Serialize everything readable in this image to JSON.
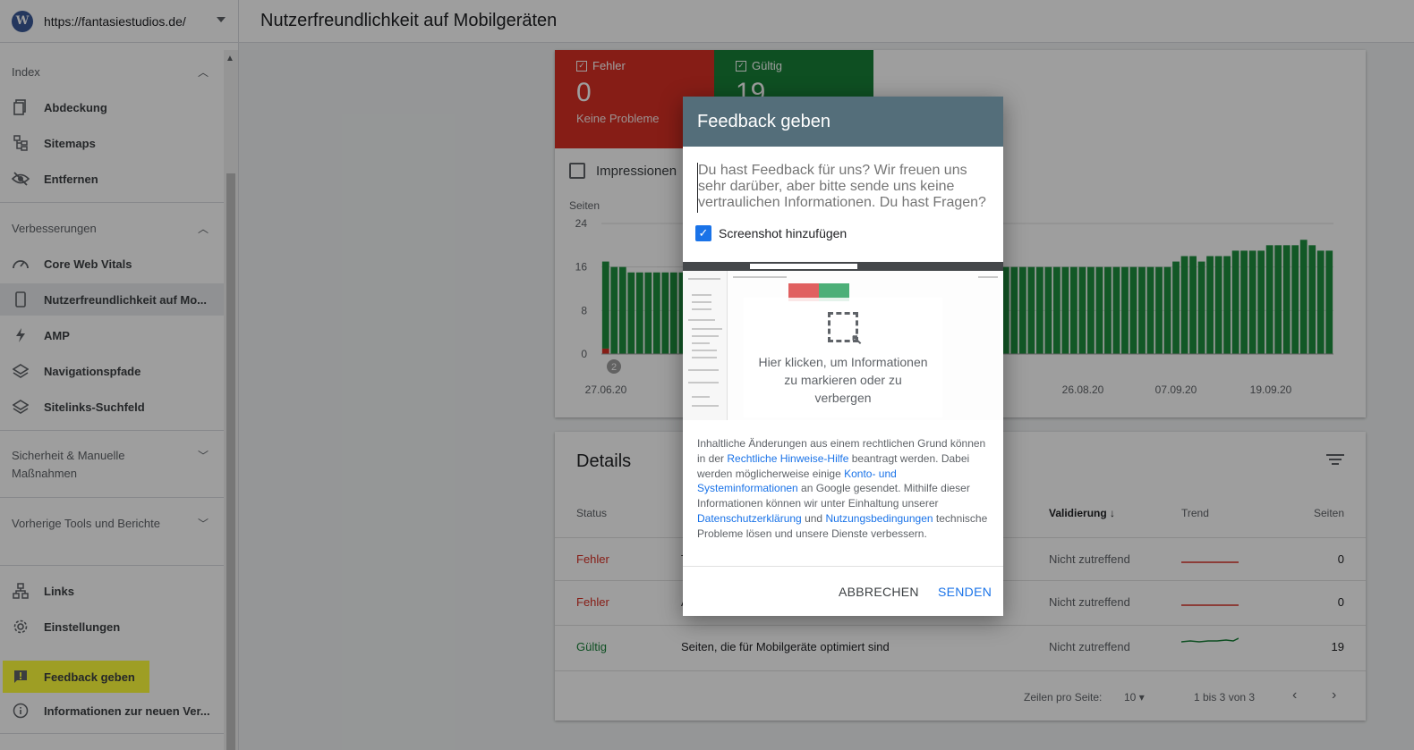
{
  "property": {
    "url": "https://fantasiestudios.de/"
  },
  "page_title": "Nutzerfreundlichkeit auf Mobilgeräten",
  "sidebar": {
    "sections": [
      {
        "header": "Index",
        "items": [
          "Abdeckung",
          "Sitemaps",
          "Entfernen"
        ]
      },
      {
        "header": "Verbesserungen",
        "items": [
          "Core Web Vitals",
          "Nutzerfreundlichkeit auf Mo...",
          "AMP",
          "Navigationspfade",
          "Sitelinks-Suchfeld"
        ]
      },
      {
        "header": "Sicherheit & Manuelle Maßnahmen"
      },
      {
        "header": "Vorherige Tools und Berichte"
      }
    ],
    "bottom_items": [
      "Links",
      "Einstellungen",
      "Feedback geben",
      "Informationen zur neuen Ver..."
    ]
  },
  "summary": {
    "error_label": "Fehler",
    "error_count": "0",
    "error_sub": "Keine Probleme",
    "valid_label": "Gültig",
    "valid_count": "19",
    "impressions_label": "Impressionen"
  },
  "chart_data": {
    "type": "bar",
    "ylabel": "Seiten",
    "yticks": [
      "0",
      "8",
      "16",
      "24"
    ],
    "ylim": [
      0,
      24
    ],
    "xticks": [
      "27.06.20",
      "26.08.20",
      "07.09.20",
      "19.09.20"
    ],
    "annotation": "2",
    "series": [
      {
        "color": "#1e8e3e",
        "values": [
          16,
          16,
          16,
          15,
          15,
          15,
          15,
          15,
          15,
          15,
          15,
          15,
          15,
          15,
          15,
          15,
          15,
          15,
          15,
          15,
          15,
          15,
          15,
          15,
          15,
          15,
          15,
          15,
          15,
          15,
          15,
          15,
          15,
          15,
          15,
          15,
          15,
          15,
          15,
          15,
          15,
          15,
          15,
          16,
          16,
          16,
          16,
          16,
          16,
          16,
          16,
          16,
          16,
          16,
          16,
          16,
          16,
          16,
          16,
          16,
          16,
          16,
          16,
          16,
          16,
          16,
          16,
          17,
          18,
          18,
          17,
          18,
          18,
          18,
          19,
          19,
          19,
          19,
          20,
          20,
          20,
          20,
          21,
          20,
          19,
          19
        ]
      },
      {
        "color": "#d93025",
        "values": [
          1,
          0,
          0,
          0,
          0,
          0,
          0,
          0,
          0,
          0,
          0,
          0,
          0,
          0,
          0,
          0,
          0,
          0,
          0,
          0,
          0,
          0,
          0,
          0,
          0,
          0,
          0,
          0,
          0,
          0,
          0,
          0,
          0,
          0,
          0,
          0,
          0,
          0,
          0,
          0,
          0,
          0,
          0,
          0,
          0,
          0,
          0,
          0,
          0,
          0,
          0,
          0,
          0,
          0,
          0,
          0,
          0,
          0,
          0,
          0,
          0,
          0,
          0,
          0,
          0,
          0,
          0,
          0,
          0,
          0,
          0,
          0,
          0,
          0,
          0,
          0,
          0,
          0,
          0,
          0,
          0,
          0,
          0,
          0,
          0,
          0
        ]
      }
    ]
  },
  "details": {
    "title": "Details",
    "columns": [
      "Status",
      "Validierung",
      "Trend",
      "Seiten"
    ],
    "rows": [
      {
        "status": "Fehler",
        "type": "T",
        "validation": "Nicht zutreffend",
        "pages": "0",
        "trend_color": "#d93025"
      },
      {
        "status": "Fehler",
        "type": "A",
        "validation": "Nicht zutreffend",
        "pages": "0",
        "trend_color": "#d93025"
      },
      {
        "status": "Gültig",
        "type": "Seiten, die für Mobilgeräte optimiert sind",
        "validation": "Nicht zutreffend",
        "pages": "19",
        "trend_color": "#188038"
      }
    ],
    "pager": {
      "rows_per_page_label": "Zeilen pro Seite:",
      "rows_per_page": "10",
      "range": "1 bis 3 von 3"
    }
  },
  "dialog": {
    "title": "Feedback geben",
    "placeholder": "Du hast Feedback für uns? Wir freuen uns sehr darüber, aber bitte sende uns keine vertraulichen Informationen. Du hast Fragen?",
    "screenshot_label": "Screenshot hinzufügen",
    "preview_hint": "Hier klicken, um Informationen zu markieren oder zu verbergen",
    "legal": {
      "t1": "Inhaltliche Änderungen aus einem rechtlichen Grund können in der ",
      "l1": "Rechtliche Hinweise-Hilfe",
      "t2": " beantragt werden. Dabei werden möglicherweise einige ",
      "l2": "Konto- und Systeminformationen",
      "t3": " an Google gesendet. Mithilfe dieser Informationen können wir unter Einhaltung unserer ",
      "l3": "Datenschutzerklärung",
      "t4": " und ",
      "l4": "Nutzungsbedingungen",
      "t5": " technische Probleme lösen und unsere Dienste verbessern."
    },
    "cancel": "ABBRECHEN",
    "send": "SENDEN"
  }
}
